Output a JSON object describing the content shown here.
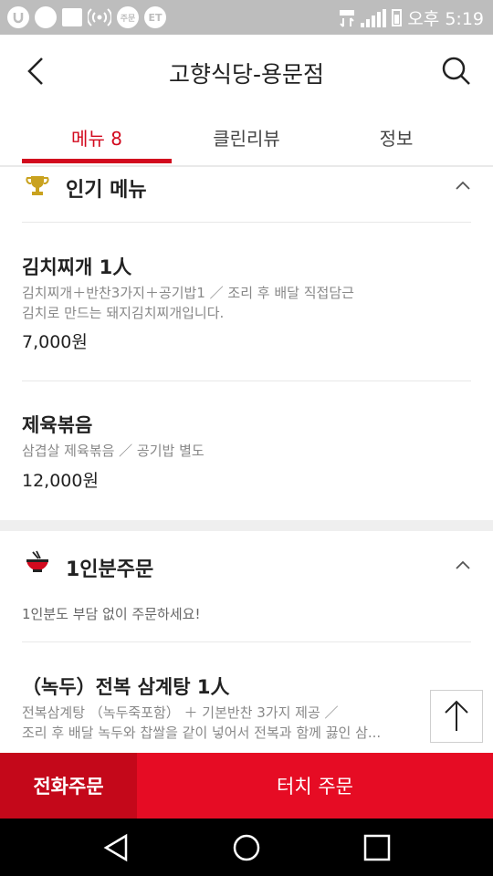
{
  "status_bar": {
    "left_icons": [
      "u-plus-icon",
      "circle-icon",
      "image-icon",
      "wifi-hotspot-icon",
      "order-notification-icon",
      "et-icon"
    ],
    "order_badge_text": "주문",
    "et_badge_text": "ET",
    "time": "오후 5:19"
  },
  "header": {
    "title": "고향식당-용문점"
  },
  "tabs": [
    {
      "label": "메뉴 8",
      "active": true
    },
    {
      "label": "클린리뷰",
      "active": false
    },
    {
      "label": "정보",
      "active": false
    }
  ],
  "sections": {
    "popular": {
      "title": "인기 메뉴",
      "items": [
        {
          "name": "김치찌개 1人",
          "desc_line1": "김치찌개＋반찬3가지＋공기밥1 ／ 조리 후 배달 직접담근",
          "desc_line2": "김치로 만드는 돼지김치찌개입니다.",
          "price": "7,000원"
        },
        {
          "name": "제육볶음",
          "desc_line1": "삼겹살 제육볶음 ／ 공기밥 별도",
          "price": "12,000원"
        }
      ]
    },
    "single": {
      "title": "1인분주문",
      "note": "1인분도 부담 없이 주문하세요!",
      "items": [
        {
          "name": "（녹두）전복 삼계탕 1人",
          "desc_line1": "전복삼계탕 （녹두죽포함） ＋ 기본반찬 3가지 제공 ／",
          "desc_line2": "조리 후 배달 녹두와 찹쌀을 같이 넣어서 전복과 함께 끓인 삼..."
        }
      ]
    }
  },
  "bottom_buttons": {
    "call": "전화주문",
    "touch": "터치 주문"
  },
  "colors": {
    "accent": "#d20a1e",
    "call_bg": "#c4081a",
    "touch_bg": "#e60c24",
    "status_bar": "#bdbdbd"
  }
}
